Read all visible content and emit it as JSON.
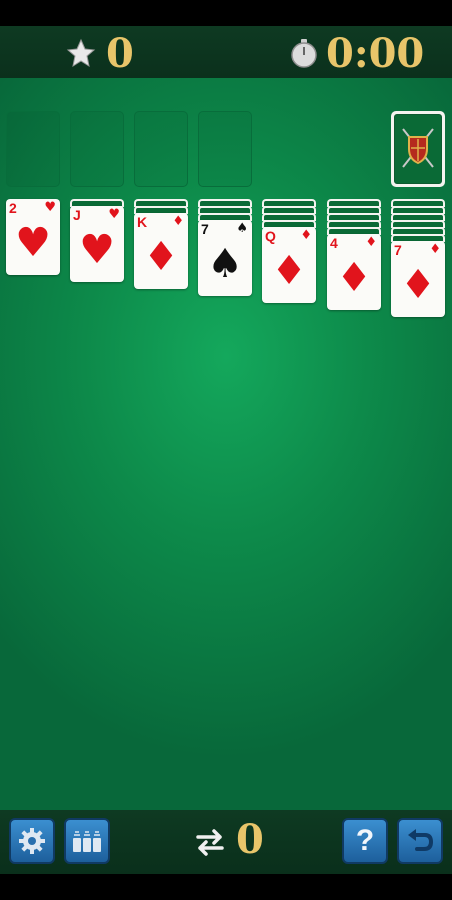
{
  "hud": {
    "score": "0",
    "timer": "0:00",
    "score_icon": "star-icon",
    "timer_icon": "stopwatch-icon"
  },
  "foundations": [
    {
      "slot": 1
    },
    {
      "slot": 2
    },
    {
      "slot": 3
    },
    {
      "slot": 4
    }
  ],
  "stock": {
    "icon": "shield-with-swords-icon"
  },
  "tableau": [
    {
      "hidden": 0,
      "rank": "2",
      "suit": "♥",
      "color": "red"
    },
    {
      "hidden": 1,
      "rank": "J",
      "suit": "♥",
      "color": "red"
    },
    {
      "hidden": 2,
      "rank": "K",
      "suit": "♦",
      "color": "red"
    },
    {
      "hidden": 3,
      "rank": "7",
      "suit": "♠",
      "color": "black"
    },
    {
      "hidden": 4,
      "rank": "Q",
      "suit": "♦",
      "color": "red"
    },
    {
      "hidden": 5,
      "rank": "4",
      "suit": "♦",
      "color": "red"
    },
    {
      "hidden": 6,
      "rank": "7",
      "suit": "♦",
      "color": "red"
    }
  ],
  "bottom": {
    "moves": "0",
    "moves_icon": "swap-arrows-icon"
  },
  "buttons": [
    {
      "name": "settings-button",
      "icon": "gear-icon"
    },
    {
      "name": "themes-button",
      "icon": "card-stacks-icon"
    },
    {
      "name": "help-button",
      "icon": "question-icon",
      "label": "?"
    },
    {
      "name": "undo-button",
      "icon": "undo-icon"
    }
  ]
}
